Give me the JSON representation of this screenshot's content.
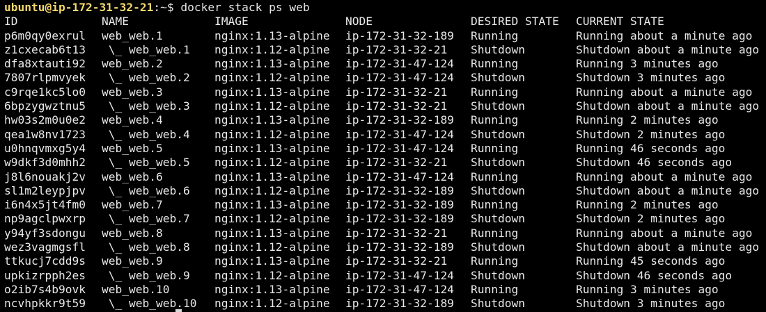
{
  "prompt": {
    "user_host": "ubuntu@ip-172-31-32-21",
    "suffix": ":~$ ",
    "command": "docker stack ps web"
  },
  "columns": [
    "ID",
    "NAME",
    "IMAGE",
    "NODE",
    "DESIRED STATE",
    "CURRENT STATE"
  ],
  "rows": [
    [
      "p6m0qy0exrul",
      "web_web.1",
      "nginx:1.13-alpine",
      "ip-172-31-32-189",
      "Running",
      "Running about a minute ago"
    ],
    [
      "z1cxecab6t13",
      " \\_ web_web.1",
      "nginx:1.12-alpine",
      "ip-172-31-32-21",
      "Shutdown",
      "Shutdown about a minute ago"
    ],
    [
      "dfa8xtauti92",
      "web_web.2",
      "nginx:1.13-alpine",
      "ip-172-31-47-124",
      "Running",
      "Running 3 minutes ago"
    ],
    [
      "7807rlpmvyek",
      " \\_ web_web.2",
      "nginx:1.12-alpine",
      "ip-172-31-47-124",
      "Shutdown",
      "Shutdown 3 minutes ago"
    ],
    [
      "c9rqe1kc5lo0",
      "web_web.3",
      "nginx:1.13-alpine",
      "ip-172-31-32-21",
      "Running",
      "Running about a minute ago"
    ],
    [
      "6bpzygwztnu5",
      " \\_ web_web.3",
      "nginx:1.12-alpine",
      "ip-172-31-32-21",
      "Shutdown",
      "Shutdown about a minute ago"
    ],
    [
      "hw03s2m0u0e2",
      "web_web.4",
      "nginx:1.13-alpine",
      "ip-172-31-32-189",
      "Running",
      "Running 2 minutes ago"
    ],
    [
      "qea1w8nv1723",
      " \\_ web_web.4",
      "nginx:1.12-alpine",
      "ip-172-31-47-124",
      "Shutdown",
      "Shutdown 2 minutes ago"
    ],
    [
      "u0hnqvmxg5y4",
      "web_web.5",
      "nginx:1.13-alpine",
      "ip-172-31-47-124",
      "Running",
      "Running 46 seconds ago"
    ],
    [
      "w9dkf3d0mhh2",
      " \\_ web_web.5",
      "nginx:1.12-alpine",
      "ip-172-31-32-21",
      "Shutdown",
      "Shutdown 46 seconds ago"
    ],
    [
      "j8l6nouakj2v",
      "web_web.6",
      "nginx:1.13-alpine",
      "ip-172-31-47-124",
      "Running",
      "Running about a minute ago"
    ],
    [
      "sl1m2leypjpv",
      " \\_ web_web.6",
      "nginx:1.12-alpine",
      "ip-172-31-32-189",
      "Shutdown",
      "Shutdown about a minute ago"
    ],
    [
      "i6n4x5jt4fm0",
      "web_web.7",
      "nginx:1.13-alpine",
      "ip-172-31-32-189",
      "Running",
      "Running 2 minutes ago"
    ],
    [
      "np9agclpwxrp",
      " \\_ web_web.7",
      "nginx:1.12-alpine",
      "ip-172-31-32-189",
      "Shutdown",
      "Shutdown 2 minutes ago"
    ],
    [
      "y94yf3sdongu",
      "web_web.8",
      "nginx:1.13-alpine",
      "ip-172-31-32-21",
      "Running",
      "Running about a minute ago"
    ],
    [
      "wez3vagmgsfl",
      " \\_ web_web.8",
      "nginx:1.12-alpine",
      "ip-172-31-32-189",
      "Shutdown",
      "Shutdown about a minute ago"
    ],
    [
      "ttkucj7cdd9s",
      "web_web.9",
      "nginx:1.13-alpine",
      "ip-172-31-32-21",
      "Running",
      "Running 45 seconds ago"
    ],
    [
      "upkizrpph2es",
      " \\_ web_web.9",
      "nginx:1.12-alpine",
      "ip-172-31-47-124",
      "Shutdown",
      "Shutdown 46 seconds ago"
    ],
    [
      "o2ib7s4b9ovk",
      "web_web.10",
      "nginx:1.13-alpine",
      "ip-172-31-47-124",
      "Running",
      "Running 3 minutes ago"
    ],
    [
      "ncvhpkkr9t59",
      " \\_ web_web.10",
      "nginx:1.12-alpine",
      "ip-172-31-32-189",
      "Shutdown",
      "Shutdown 3 minutes ago"
    ]
  ],
  "colors": {
    "background": "#000000",
    "text": "#e8e8e8",
    "user_host": "#f5d76e"
  }
}
